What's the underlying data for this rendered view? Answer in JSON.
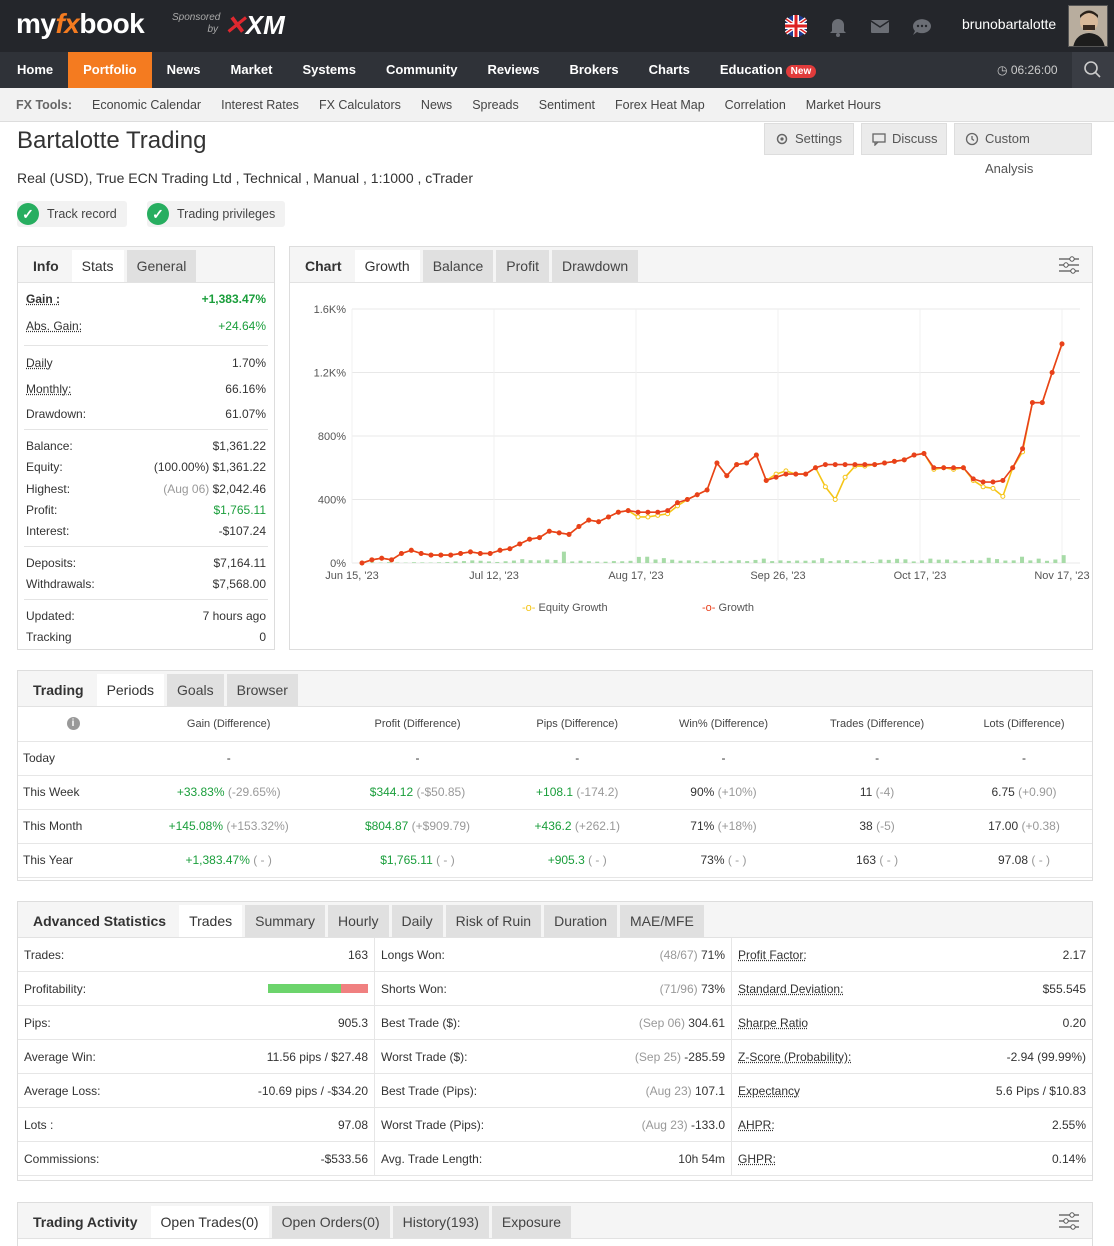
{
  "brand": {
    "logo_pre": "my",
    "logo_fx": "fx",
    "logo_post": "book",
    "sponsored": "Sponsored",
    "by": "by",
    "xm": "XM"
  },
  "user": {
    "name": "brunobartalotte"
  },
  "nav": {
    "items": [
      "Home",
      "Portfolio",
      "News",
      "Market",
      "Systems",
      "Community",
      "Reviews",
      "Brokers",
      "Charts",
      "Education"
    ],
    "active": "Portfolio",
    "new_badge": "New",
    "clock": "06:26:00"
  },
  "fxtools": {
    "label": "FX Tools:",
    "links": [
      "Economic Calendar",
      "Interest Rates",
      "FX Calculators",
      "News",
      "Spreads",
      "Sentiment",
      "Forex Heat Map",
      "Correlation",
      "Market Hours"
    ]
  },
  "account": {
    "title": "Bartalotte Trading",
    "subtitle": "Real (USD), True ECN Trading Ltd , Technical , Manual , 1:1000 , cTrader",
    "buttons": {
      "settings": "Settings",
      "discuss": "Discuss",
      "custom": "Custom Analysis"
    },
    "badges": {
      "track": "Track record",
      "privileges": "Trading privileges"
    }
  },
  "info": {
    "tabs": [
      "Info",
      "Stats",
      "General"
    ],
    "gain": {
      "k": "Gain :",
      "v": "+1,383.47%"
    },
    "abs_gain": {
      "k": "Abs. Gain:",
      "v": "+24.64%"
    },
    "daily": {
      "k": "Daily",
      "v": "1.70%"
    },
    "monthly": {
      "k": "Monthly:",
      "v": "66.16%"
    },
    "drawdown": {
      "k": "Drawdown:",
      "v": "61.07%"
    },
    "balance": {
      "k": "Balance:",
      "v": "$1,361.22"
    },
    "equity": {
      "k": "Equity:",
      "note": "(100.00%)",
      "v": "$1,361.22"
    },
    "highest": {
      "k": "Highest:",
      "note": "(Aug 06)",
      "v": "$2,042.46"
    },
    "profit": {
      "k": "Profit:",
      "v": "$1,765.11"
    },
    "interest": {
      "k": "Interest:",
      "v": "-$107.24"
    },
    "deposits": {
      "k": "Deposits:",
      "v": "$7,164.11"
    },
    "withdrawals": {
      "k": "Withdrawals:",
      "v": "$7,568.00"
    },
    "updated": {
      "k": "Updated:",
      "v": "7 hours ago"
    },
    "tracking": {
      "k": "Tracking",
      "v": "0"
    }
  },
  "chart_tabs": [
    "Chart",
    "Growth",
    "Balance",
    "Profit",
    "Drawdown"
  ],
  "chart_data": {
    "type": "line",
    "x_ticks": [
      "Jun 15, '23",
      "Jul 12, '23",
      "Aug 17, '23",
      "Sep 26, '23",
      "Oct 17, '23",
      "Nov 17, '23"
    ],
    "y_ticks": [
      "0%",
      "400%",
      "800%",
      "1.2K%",
      "1.6K%"
    ],
    "ylim": [
      0,
      1600
    ],
    "series": [
      {
        "name": "Equity Growth",
        "color": "#f5c518",
        "values": [
          0,
          20,
          30,
          20,
          60,
          80,
          60,
          50,
          50,
          50,
          60,
          70,
          60,
          60,
          80,
          90,
          120,
          150,
          160,
          200,
          190,
          180,
          230,
          270,
          260,
          290,
          320,
          330,
          290,
          290,
          300,
          310,
          360,
          400,
          430,
          460,
          630,
          550,
          620,
          630,
          680,
          520,
          560,
          580,
          560,
          560,
          600,
          480,
          400,
          540,
          610,
          610,
          620,
          630,
          640,
          650,
          680,
          690,
          590,
          600,
          590,
          600,
          520,
          480,
          470,
          420,
          600,
          700,
          1010,
          1010,
          1200,
          1380
        ]
      },
      {
        "name": "Growth",
        "color": "#e8401c",
        "values": [
          0,
          20,
          30,
          20,
          60,
          80,
          60,
          50,
          50,
          50,
          60,
          70,
          60,
          60,
          80,
          90,
          120,
          150,
          160,
          200,
          190,
          180,
          230,
          270,
          260,
          290,
          320,
          330,
          320,
          320,
          320,
          330,
          380,
          400,
          430,
          460,
          630,
          550,
          620,
          630,
          680,
          520,
          540,
          560,
          560,
          560,
          600,
          620,
          620,
          620,
          620,
          620,
          620,
          630,
          640,
          650,
          680,
          690,
          600,
          600,
          600,
          600,
          530,
          510,
          510,
          520,
          600,
          720,
          1010,
          1010,
          1200,
          1380
        ]
      }
    ],
    "bars": [
      12,
      8,
      5,
      10,
      6,
      4,
      9,
      7,
      5,
      8,
      12,
      18,
      22,
      30,
      26,
      18,
      12,
      20,
      28,
      44,
      32,
      30,
      40,
      35,
      130,
      18,
      26,
      20,
      16,
      15,
      22,
      20,
      25,
      70,
      72,
      40,
      56,
      38,
      26,
      30,
      24,
      18,
      30,
      20,
      25,
      32,
      22,
      35,
      50,
      22,
      30,
      24,
      28,
      26,
      30,
      55,
      22,
      30,
      34,
      20,
      26,
      12,
      40,
      36,
      48,
      42,
      18,
      30,
      50,
      38,
      40,
      28,
      24,
      36,
      30,
      60,
      45,
      28,
      30,
      72,
      30,
      50,
      25,
      40,
      90
    ]
  },
  "trading": {
    "tabs": [
      "Trading",
      "Periods",
      "Goals",
      "Browser"
    ],
    "headers": [
      "",
      "Gain (Difference)",
      "Profit (Difference)",
      "Pips (Difference)",
      "Win% (Difference)",
      "Trades (Difference)",
      "Lots (Difference)"
    ],
    "rows": [
      {
        "label": "Today",
        "gain": "-",
        "gain_d": "",
        "profit": "-",
        "profit_d": "",
        "pips": "-",
        "pips_d": "",
        "win": "-",
        "win_d": "",
        "trades": "-",
        "trades_d": "",
        "lots": "-",
        "lots_d": ""
      },
      {
        "label": "This Week",
        "gain": "+33.83%",
        "gain_d": "(-29.65%)",
        "profit": "$344.12",
        "profit_d": "(-$50.85)",
        "pips": "+108.1",
        "pips_d": "(-174.2)",
        "win": "90%",
        "win_d": "(+10%)",
        "trades": "11",
        "trades_d": "(-4)",
        "lots": "6.75",
        "lots_d": "(+0.90)"
      },
      {
        "label": "This Month",
        "gain": "+145.08%",
        "gain_d": "(+153.32%)",
        "profit": "$804.87",
        "profit_d": "(+$909.79)",
        "pips": "+436.2",
        "pips_d": "(+262.1)",
        "win": "71%",
        "win_d": "(+18%)",
        "trades": "38",
        "trades_d": "(-5)",
        "lots": "17.00",
        "lots_d": "(+0.38)"
      },
      {
        "label": "This Year",
        "gain": "+1,383.47%",
        "gain_d": "( - )",
        "profit": "$1,765.11",
        "profit_d": "( - )",
        "pips": "+905.3",
        "pips_d": "( - )",
        "win": "73%",
        "win_d": "( - )",
        "trades": "163",
        "trades_d": "( - )",
        "lots": "97.08",
        "lots_d": "( - )"
      }
    ]
  },
  "advanced": {
    "tabs": [
      "Advanced Statistics",
      "Trades",
      "Summary",
      "Hourly",
      "Daily",
      "Risk of Ruin",
      "Duration",
      "MAE/MFE"
    ],
    "col1": [
      {
        "k": "Trades:",
        "v": "163"
      },
      {
        "k": "Profitability:",
        "v": ""
      },
      {
        "k": "Pips:",
        "v": "905.3"
      },
      {
        "k": "Average Win:",
        "v": "11.56 pips / $27.48"
      },
      {
        "k": "Average Loss:",
        "v": "-10.69 pips / -$34.20"
      },
      {
        "k": "Lots :",
        "v": "97.08"
      },
      {
        "k": "Commissions:",
        "v": "-$533.56"
      }
    ],
    "profitability": 0.73,
    "col2": [
      {
        "k": "Longs Won:",
        "n": "(48/67)",
        "v": "71%"
      },
      {
        "k": "Shorts Won:",
        "n": "(71/96)",
        "v": "73%"
      },
      {
        "k": "Best Trade ($):",
        "n": "(Sep 06)",
        "v": "304.61"
      },
      {
        "k": "Worst Trade ($):",
        "n": "(Sep 25)",
        "v": "-285.59"
      },
      {
        "k": "Best Trade (Pips):",
        "n": "(Aug 23)",
        "v": "107.1"
      },
      {
        "k": "Worst Trade (Pips):",
        "n": "(Aug 23)",
        "v": "-133.0"
      },
      {
        "k": "Avg. Trade Length:",
        "n": "",
        "v": "10h 54m"
      }
    ],
    "col3": [
      {
        "k": "Profit Factor:",
        "v": "2.17"
      },
      {
        "k": "Standard Deviation:",
        "v": "$55.545"
      },
      {
        "k": "Sharpe Ratio",
        "v": "0.20"
      },
      {
        "k": "Z-Score (Probability):",
        "v": "-2.94 (99.99%)"
      },
      {
        "k": "Expectancy",
        "v": "5.6 Pips / $10.83"
      },
      {
        "k": "AHPR:",
        "v": "2.55%"
      },
      {
        "k": "GHPR:",
        "v": "0.14%"
      }
    ]
  },
  "activity": {
    "tabs": [
      "Trading Activity",
      "Open Trades(0)",
      "Open Orders(0)",
      "History(193)",
      "Exposure"
    ]
  }
}
